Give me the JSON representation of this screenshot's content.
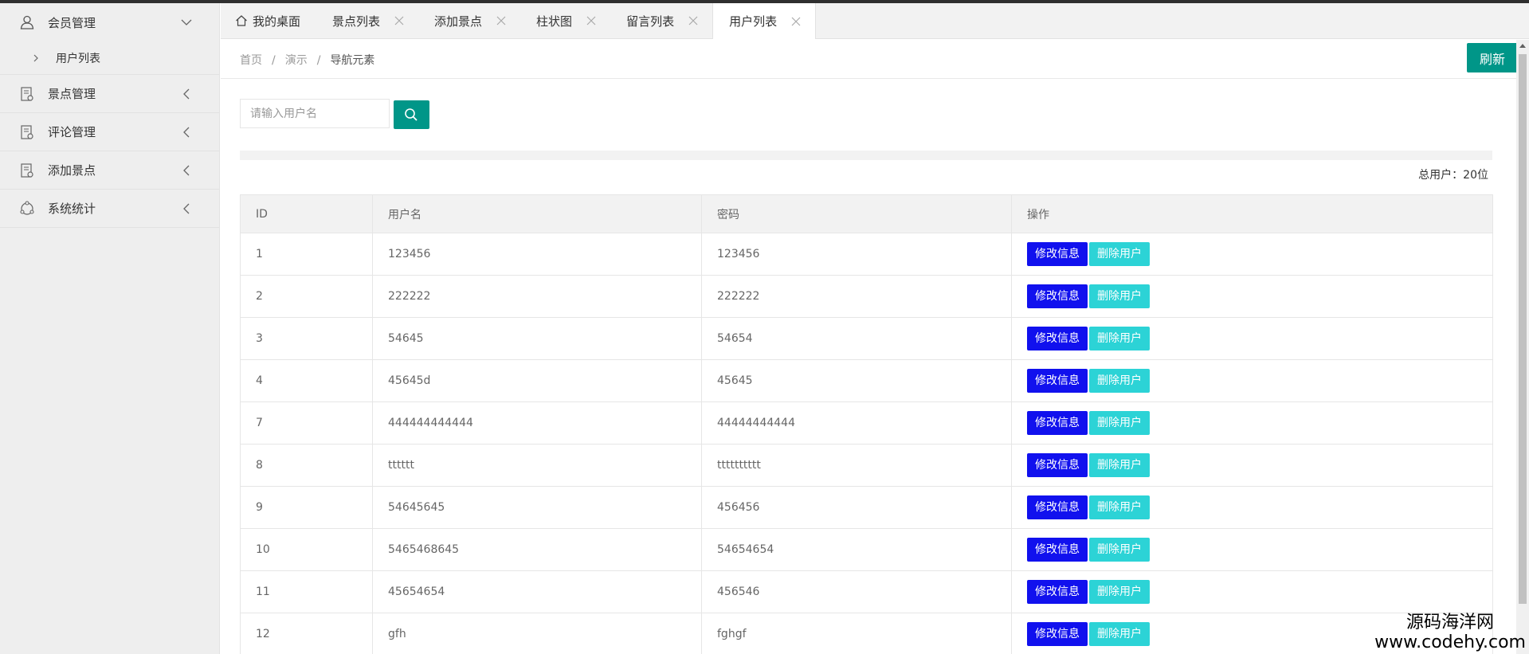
{
  "sidebar": {
    "items": [
      {
        "label": "会员管理",
        "icon": "user-icon",
        "expanded": true,
        "sub": [
          {
            "label": "用户列表"
          }
        ]
      },
      {
        "label": "景点管理",
        "icon": "document-icon",
        "expanded": false
      },
      {
        "label": "评论管理",
        "icon": "document-icon",
        "expanded": false
      },
      {
        "label": "添加景点",
        "icon": "document-icon",
        "expanded": false
      },
      {
        "label": "系统统计",
        "icon": "stats-icon",
        "expanded": false
      }
    ]
  },
  "tabs": [
    {
      "label": "我的桌面",
      "active": false,
      "closable": false,
      "icon": "home-icon"
    },
    {
      "label": "景点列表",
      "active": false,
      "closable": true
    },
    {
      "label": "添加景点",
      "active": false,
      "closable": true
    },
    {
      "label": "柱状图",
      "active": false,
      "closable": true
    },
    {
      "label": "留言列表",
      "active": false,
      "closable": true
    },
    {
      "label": "用户列表",
      "active": true,
      "closable": true
    }
  ],
  "breadcrumb": [
    "首页",
    "演示",
    "导航元素"
  ],
  "breadcrumb_sep": "/",
  "refresh_label": "刷新",
  "search": {
    "placeholder": "请输入用户名",
    "value": ""
  },
  "total_text": "总用户：20位",
  "table": {
    "headers": [
      "ID",
      "用户名",
      "密码",
      "操作"
    ],
    "rows": [
      [
        "1",
        "123456",
        "123456"
      ],
      [
        "2",
        "222222",
        "222222"
      ],
      [
        "3",
        "54645",
        "54654"
      ],
      [
        "4",
        "45645d",
        "45645"
      ],
      [
        "7",
        "444444444444",
        "44444444444"
      ],
      [
        "8",
        "tttttt",
        "tttttttttt"
      ],
      [
        "9",
        "54645645",
        "456456"
      ],
      [
        "10",
        "5465468645",
        "54654654"
      ],
      [
        "11",
        "45654654",
        "456546"
      ],
      [
        "12",
        "gfh",
        "fghgf"
      ]
    ],
    "edit_label": "修改信息",
    "delete_label": "删除用户"
  },
  "watermark": {
    "line1": "源码海洋网",
    "line2": "www.codehy.com"
  },
  "colors": {
    "accent": "#009688",
    "edit": "#1111ee",
    "delete": "#2cd3d6"
  }
}
